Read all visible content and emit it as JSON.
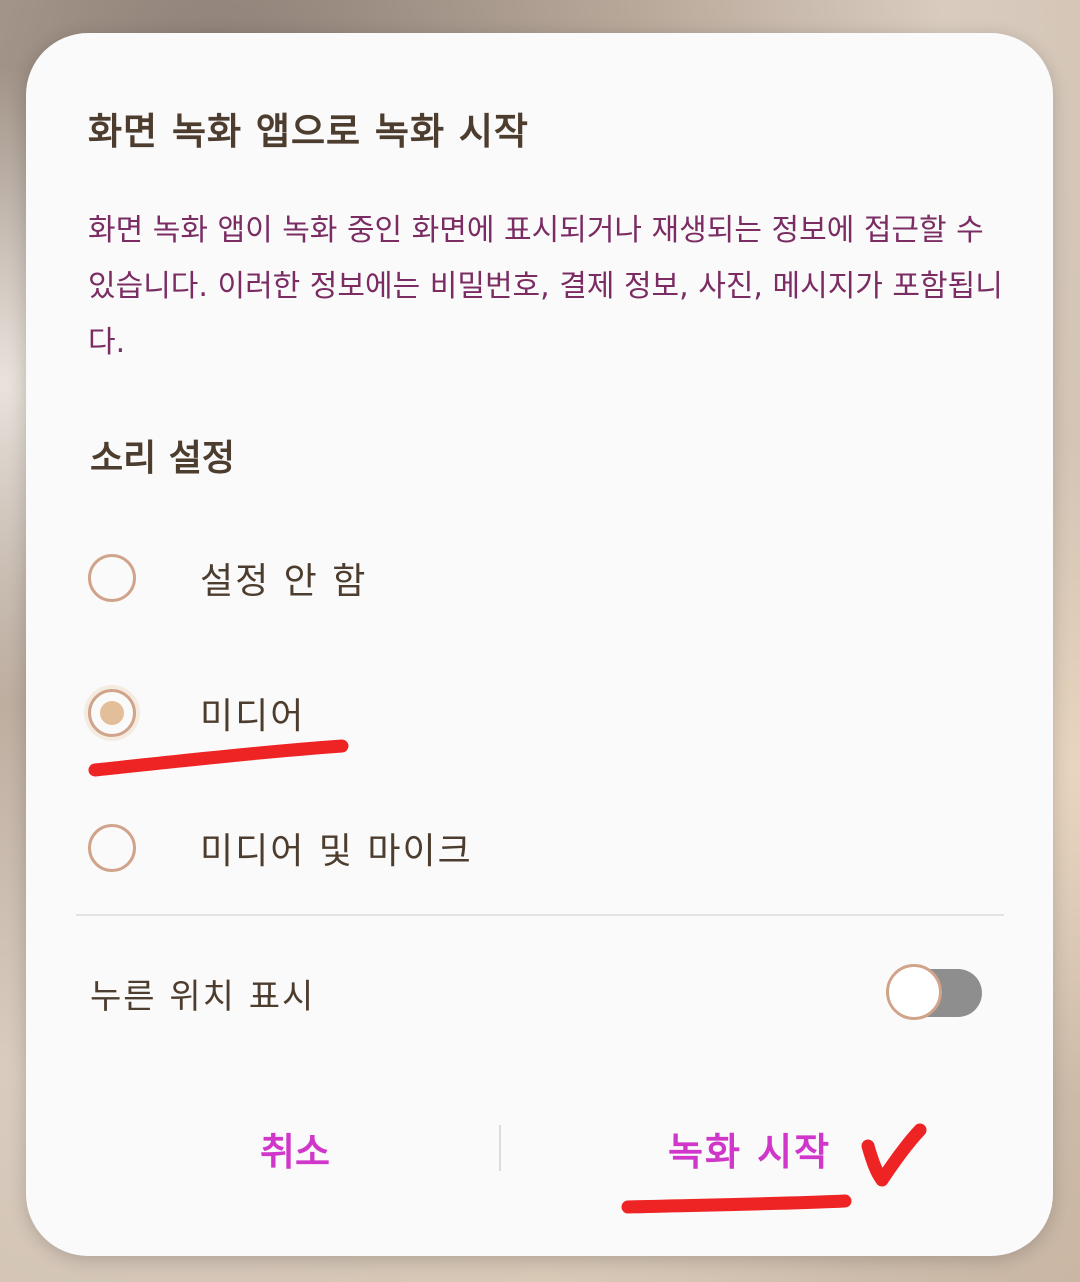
{
  "dialog": {
    "title": "화면 녹화 앱으로 녹화 시작",
    "description": "화면 녹화 앱이 녹화 중인 화면에 표시되거나 재생되는 정보에 접근할 수 있습니다. 이러한 정보에는 비밀번호, 결제 정보, 사진, 메시지가 포함됩니다.",
    "sound_section": {
      "label": "소리 설정",
      "options": [
        {
          "label": "설정 안 함",
          "selected": false
        },
        {
          "label": "미디어",
          "selected": true
        },
        {
          "label": "미디어 및 마이크",
          "selected": false
        }
      ]
    },
    "show_touches": {
      "label": "누른 위치 표시",
      "enabled": false
    },
    "buttons": {
      "cancel": "취소",
      "start": "녹화 시작"
    }
  },
  "colors": {
    "accent": "#cf36c9",
    "description_text": "#7a2c63",
    "heading_text": "#4d3d2e",
    "radio_border": "#d0a48a",
    "radio_fill": "#e2bf98",
    "annotation_red": "#ee2323"
  }
}
